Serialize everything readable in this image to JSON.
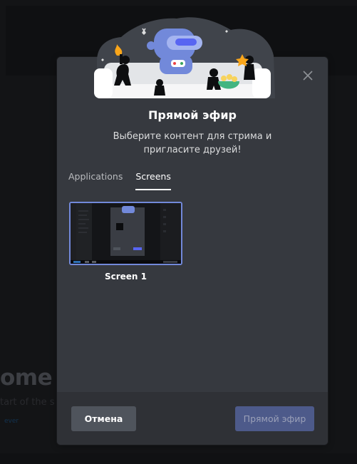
{
  "background": {
    "welcome_text": "ome to",
    "sub_text": "tart of the s",
    "link_text": "ever"
  },
  "modal": {
    "title": "Прямой эфир",
    "subtitle": "Выберите контент для стрима и пригласите друзей!",
    "tabs": [
      {
        "label": "Applications",
        "active": false
      },
      {
        "label": "Screens",
        "active": true
      }
    ],
    "screens": [
      {
        "label": "Screen 1",
        "selected": true
      }
    ],
    "cancel_label": "Отмена",
    "go_live_label": "Прямой эфир"
  },
  "colors": {
    "accent": "#7289da",
    "modal_bg": "#36393f",
    "footer_bg": "#2f3136",
    "cancel_bg": "#4f545c",
    "go_live_disabled_bg": "#4d5a8a"
  },
  "icons": {
    "close": "close-icon",
    "illustration": "stream-illustration"
  }
}
